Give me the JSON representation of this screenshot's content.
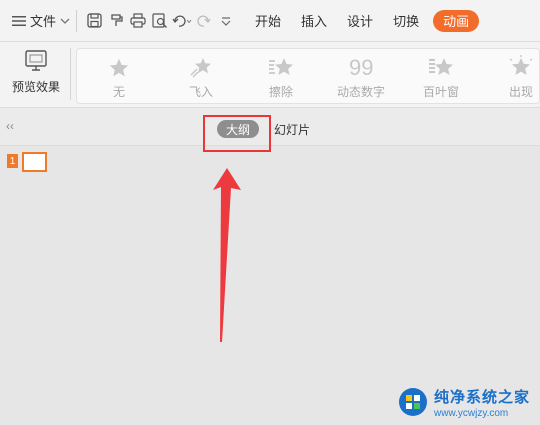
{
  "menubar": {
    "file_label": "文件",
    "tabs": [
      {
        "label": "开始"
      },
      {
        "label": "插入"
      },
      {
        "label": "设计"
      },
      {
        "label": "切换"
      },
      {
        "label": "动画"
      }
    ],
    "active_color": "#f26d2b"
  },
  "ribbon": {
    "preview_label": "预览效果",
    "effects": [
      {
        "label": "无",
        "icon": "star-icon"
      },
      {
        "label": "飞入",
        "icon": "fly-in-star-icon"
      },
      {
        "label": "擦除",
        "icon": "wipe-star-icon"
      },
      {
        "label": "动态数字",
        "icon": "dynamic-number-icon"
      },
      {
        "label": "百叶窗",
        "icon": "blinds-star-icon"
      },
      {
        "label": "出现",
        "icon": "appear-star-icon"
      }
    ]
  },
  "panel": {
    "outline_tab": "大纲",
    "slides_tab": "幻灯片",
    "slides": [
      {
        "number": "1"
      }
    ]
  },
  "watermark": {
    "title": "纯净系统之家",
    "url": "www.ycwjzy.com"
  }
}
